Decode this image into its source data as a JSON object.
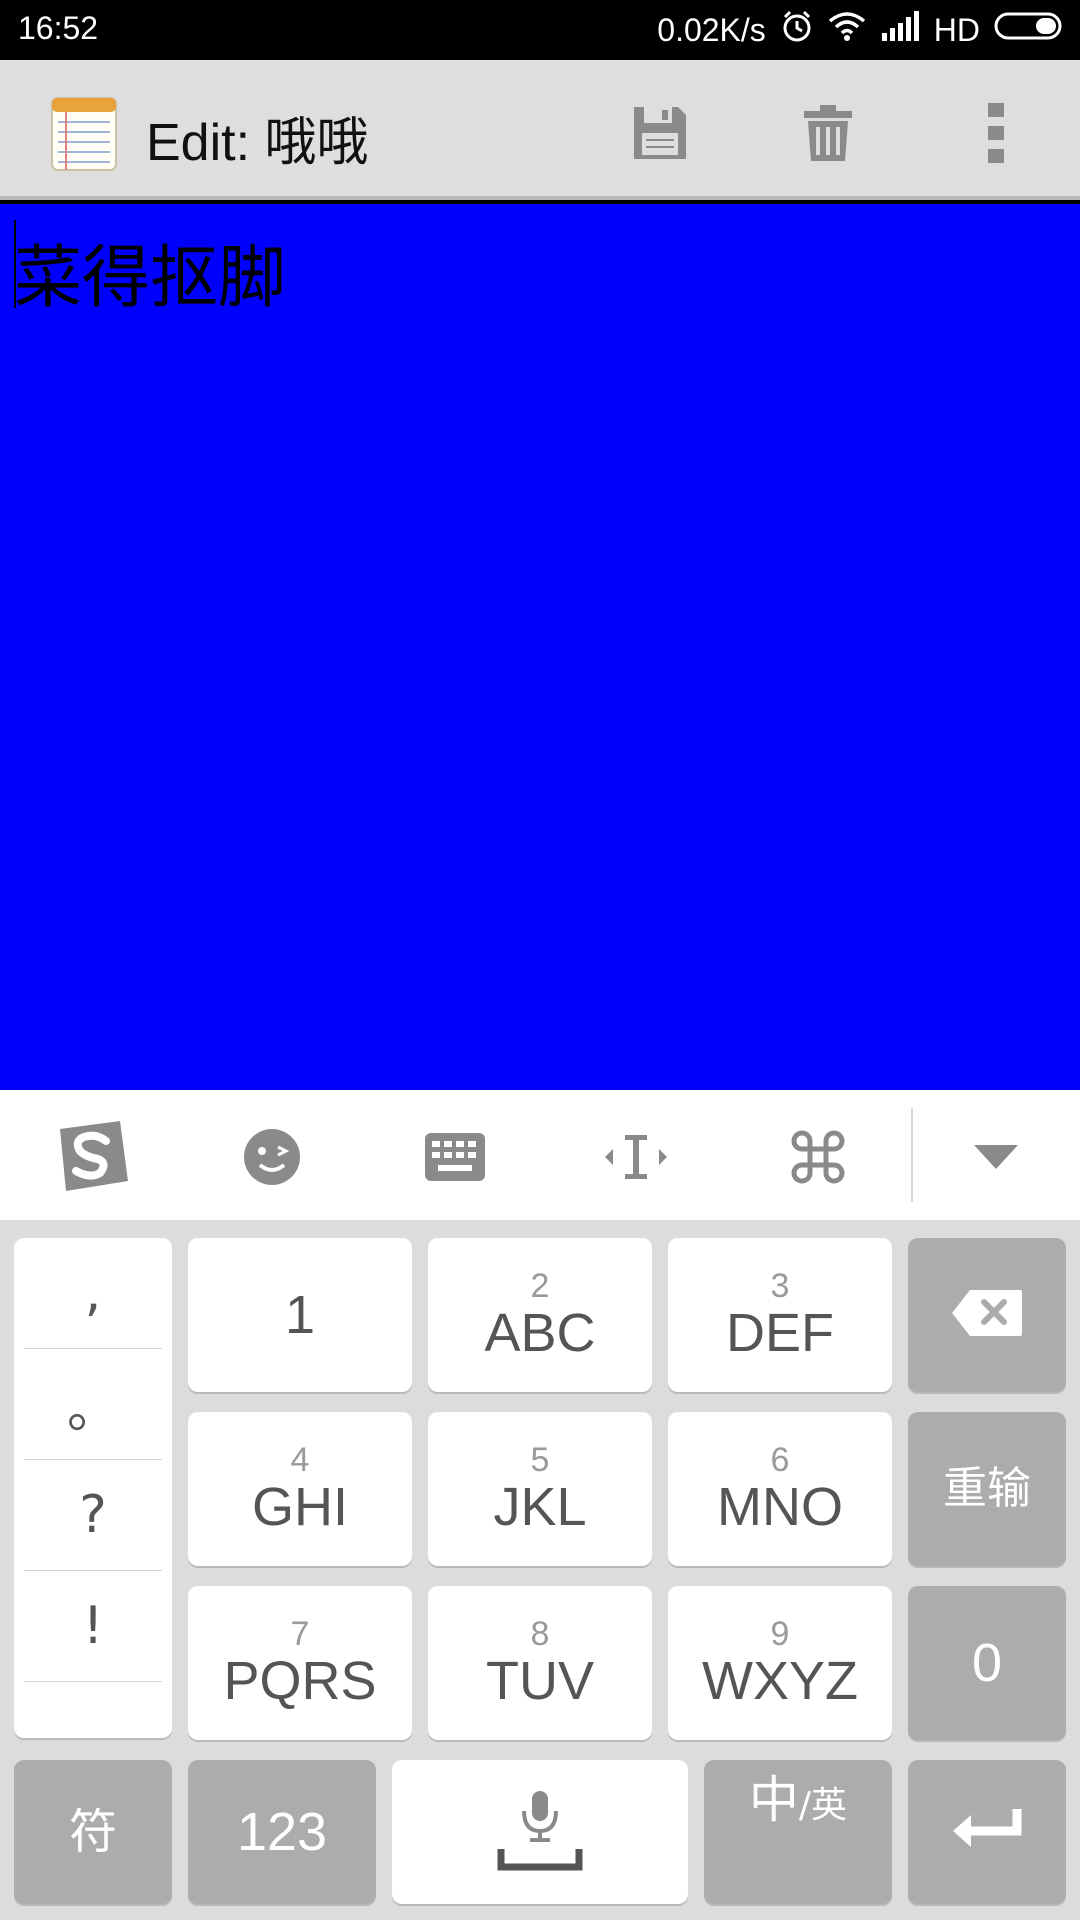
{
  "status_bar": {
    "time": "16:52",
    "net_speed": "0.02K/s",
    "hd_label": "HD",
    "icons": [
      "alarm-icon",
      "wifi-icon",
      "signal-icon",
      "battery-icon"
    ]
  },
  "app_bar": {
    "title": "Edit: 哦哦",
    "app_icon": "notepad-icon",
    "actions": [
      "save-icon",
      "delete-icon",
      "overflow-menu-icon"
    ]
  },
  "editor": {
    "text": "菜得抠脚",
    "background": "#0000ff"
  },
  "keyboard_toolbar": {
    "items": [
      "sogou-logo-icon",
      "emoji-icon",
      "keyboard-icon",
      "cursor-move-icon",
      "command-icon",
      "collapse-icon"
    ]
  },
  "keyboard": {
    "punctuation": [
      ",",
      "。",
      "?",
      "!"
    ],
    "rows": [
      [
        {
          "sub": "",
          "main": "1"
        },
        {
          "sub": "2",
          "main": "ABC"
        },
        {
          "sub": "3",
          "main": "DEF"
        }
      ],
      [
        {
          "sub": "4",
          "main": "GHI"
        },
        {
          "sub": "5",
          "main": "JKL"
        },
        {
          "sub": "6",
          "main": "MNO"
        }
      ],
      [
        {
          "sub": "7",
          "main": "PQRS"
        },
        {
          "sub": "8",
          "main": "TUV"
        },
        {
          "sub": "9",
          "main": "WXYZ"
        }
      ]
    ],
    "reinput_label": "重输",
    "zero_label": "0",
    "symbol_label": "符",
    "num_label": "123",
    "lang_main": "中",
    "lang_sub": "/英"
  }
}
